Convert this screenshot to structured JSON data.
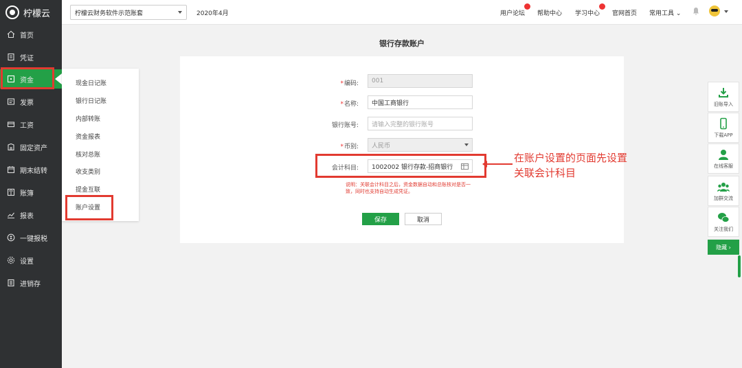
{
  "brand": {
    "name": "柠檬云"
  },
  "topbar": {
    "account_set": "柠檬云财务软件示范账套",
    "period": "2020年4月",
    "links": {
      "forum": "用户论坛",
      "help": "帮助中心",
      "learn": "学习中心",
      "homepage": "官网首页",
      "tools": "常用工具"
    }
  },
  "sidebar": {
    "items": [
      {
        "label": "首页",
        "icon": "home-icon"
      },
      {
        "label": "凭证",
        "icon": "voucher-icon"
      },
      {
        "label": "资金",
        "icon": "funds-icon"
      },
      {
        "label": "发票",
        "icon": "invoice-icon"
      },
      {
        "label": "工资",
        "icon": "salary-icon"
      },
      {
        "label": "固定资产",
        "icon": "asset-icon"
      },
      {
        "label": "期末结转",
        "icon": "calendar-icon"
      },
      {
        "label": "账簿",
        "icon": "book-icon"
      },
      {
        "label": "报表",
        "icon": "chart-icon"
      },
      {
        "label": "一键报税",
        "icon": "tax-icon"
      },
      {
        "label": "设置",
        "icon": "gear-icon"
      },
      {
        "label": "进销存",
        "icon": "inventory-icon"
      }
    ],
    "active_index": 2
  },
  "submenu": {
    "items": [
      "现金日记账",
      "银行日记账",
      "内部转账",
      "资金报表",
      "核对总账",
      "收支类别",
      "提金互联",
      "账户设置"
    ]
  },
  "page": {
    "title": "银行存款账户"
  },
  "form": {
    "code": {
      "label": "编码:",
      "value": "001"
    },
    "name": {
      "label": "名称:",
      "value": "中国工商银行"
    },
    "bank_account": {
      "label": "银行账号:",
      "placeholder": "请输入完整的银行账号"
    },
    "currency": {
      "label": "币别:",
      "value": "人民币"
    },
    "subject": {
      "label": "会计科目:",
      "value": "1002002 银行存款-招商银行"
    },
    "hint": "说明：关联会计科目之后，资金数据自动和总账核对是否一致，同时也支持自动生成凭证。",
    "save_label": "保存",
    "cancel_label": "取消"
  },
  "annotation": {
    "text": "在账户设置的页面先设置关联会计科目"
  },
  "rail": {
    "items": [
      {
        "label": "旧账导入",
        "icon": "import-icon"
      },
      {
        "label": "下载APP",
        "icon": "phone-icon"
      },
      {
        "label": "在线客服",
        "icon": "service-icon"
      },
      {
        "label": "加群交流",
        "icon": "group-icon"
      },
      {
        "label": "关注我们",
        "icon": "wechat-icon"
      }
    ],
    "hide_label": "隐藏 ›"
  },
  "colors": {
    "accent": "#23a047",
    "sidebar": "#2f3133",
    "highlight": "#e23a30"
  }
}
